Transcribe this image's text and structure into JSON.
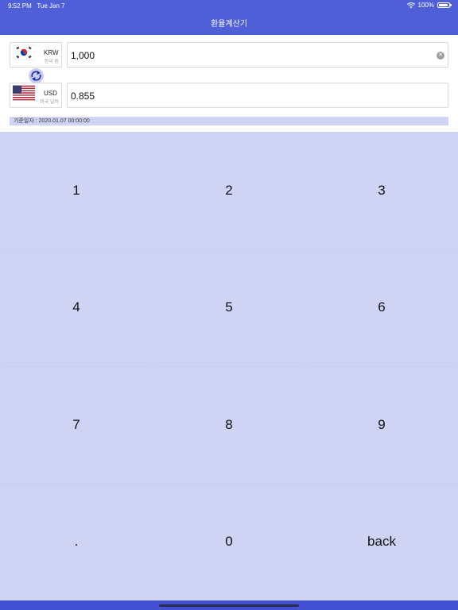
{
  "status_bar": {
    "time": "9:52 PM",
    "date": "Tue Jan 7",
    "battery": "100%",
    "icons": [
      "wifi-icon",
      "battery-icon"
    ]
  },
  "header": {
    "title": "환율계산기"
  },
  "source": {
    "code": "KRW",
    "name": "한국 원",
    "amount": "1,000",
    "flag": "south-korea-flag"
  },
  "target": {
    "code": "USD",
    "name": "미국 달러",
    "amount": "0.855",
    "flag": "usa-flag"
  },
  "base_date": "기준일자 : 2020.01.07 00:00:00",
  "keypad": {
    "keys": [
      "1",
      "2",
      "3",
      "4",
      "5",
      "6",
      "7",
      "8",
      "9",
      ".",
      "0",
      "back"
    ]
  },
  "colors": {
    "header": "#4f5fd8",
    "keypad_bg": "#d0d4f4",
    "footer": "#4450d4"
  }
}
